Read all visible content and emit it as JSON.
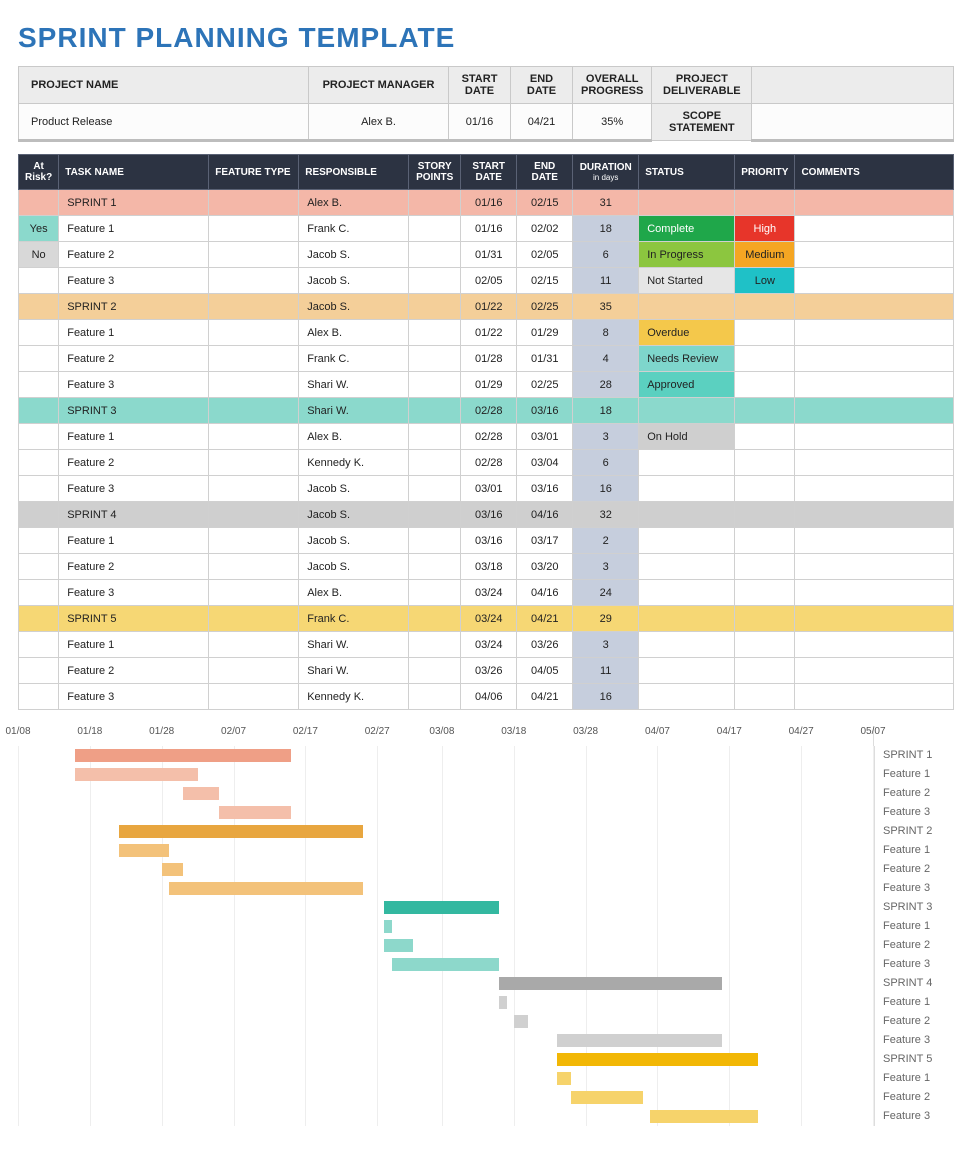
{
  "title": "SPRINT PLANNING TEMPLATE",
  "project_header": {
    "labels": {
      "project_name": "PROJECT NAME",
      "project_manager": "PROJECT MANAGER",
      "start_date": "START DATE",
      "end_date": "END DATE",
      "overall_progress": "OVERALL PROGRESS",
      "project_deliverable": "PROJECT DELIVERABLE",
      "scope_statement": "SCOPE STATEMENT"
    },
    "values": {
      "project_name": "Product Release",
      "project_manager": "Alex B.",
      "start_date": "01/16",
      "end_date": "04/21",
      "overall_progress": "35%",
      "project_deliverable": "",
      "scope_statement": ""
    }
  },
  "grid_headers": {
    "at_risk": "At Risk?",
    "task_name": "TASK NAME",
    "feature_type": "FEATURE TYPE",
    "responsible": "RESPONSIBLE",
    "story_points": "STORY POINTS",
    "start_date": "START DATE",
    "end_date": "END DATE",
    "duration": "DURATION",
    "duration_sub": "in days",
    "status": "STATUS",
    "priority": "PRIORITY",
    "comments": "COMMENTS"
  },
  "rows": [
    {
      "type": "sprint",
      "bg": "bg-sprint1",
      "task": "SPRINT 1",
      "responsible": "Alex B.",
      "start": "01/16",
      "end": "02/15",
      "dur": "31"
    },
    {
      "type": "task",
      "risk": "Yes",
      "task": "Feature 1",
      "responsible": "Frank C.",
      "start": "01/16",
      "end": "02/02",
      "dur": "18",
      "status": "Complete",
      "priority": "High"
    },
    {
      "type": "task",
      "risk": "No",
      "task": "Feature 2",
      "responsible": "Jacob S.",
      "start": "01/31",
      "end": "02/05",
      "dur": "6",
      "status": "In Progress",
      "priority": "Medium"
    },
    {
      "type": "task",
      "task": "Feature 3",
      "responsible": "Jacob S.",
      "start": "02/05",
      "end": "02/15",
      "dur": "11",
      "status": "Not Started",
      "priority": "Low"
    },
    {
      "type": "sprint",
      "bg": "bg-sprint2",
      "task": "SPRINT 2",
      "responsible": "Jacob S.",
      "start": "01/22",
      "end": "02/25",
      "dur": "35"
    },
    {
      "type": "task",
      "task": "Feature 1",
      "responsible": "Alex B.",
      "start": "01/22",
      "end": "01/29",
      "dur": "8",
      "status": "Overdue"
    },
    {
      "type": "task",
      "task": "Feature 2",
      "responsible": "Frank C.",
      "start": "01/28",
      "end": "01/31",
      "dur": "4",
      "status": "Needs Review"
    },
    {
      "type": "task",
      "task": "Feature 3",
      "responsible": "Shari W.",
      "start": "01/29",
      "end": "02/25",
      "dur": "28",
      "status": "Approved"
    },
    {
      "type": "sprint",
      "bg": "bg-sprint3",
      "task": "SPRINT 3",
      "responsible": "Shari W.",
      "start": "02/28",
      "end": "03/16",
      "dur": "18"
    },
    {
      "type": "task",
      "task": "Feature 1",
      "responsible": "Alex B.",
      "start": "02/28",
      "end": "03/01",
      "dur": "3",
      "status": "On Hold"
    },
    {
      "type": "task",
      "task": "Feature 2",
      "responsible": "Kennedy K.",
      "start": "02/28",
      "end": "03/04",
      "dur": "6"
    },
    {
      "type": "task",
      "task": "Feature 3",
      "responsible": "Jacob S.",
      "start": "03/01",
      "end": "03/16",
      "dur": "16"
    },
    {
      "type": "sprint",
      "bg": "bg-sprint4",
      "task": "SPRINT 4",
      "responsible": "Jacob S.",
      "start": "03/16",
      "end": "04/16",
      "dur": "32"
    },
    {
      "type": "task",
      "task": "Feature 1",
      "responsible": "Jacob S.",
      "start": "03/16",
      "end": "03/17",
      "dur": "2"
    },
    {
      "type": "task",
      "task": "Feature 2",
      "responsible": "Jacob S.",
      "start": "03/18",
      "end": "03/20",
      "dur": "3"
    },
    {
      "type": "task",
      "task": "Feature 3",
      "responsible": "Alex B.",
      "start": "03/24",
      "end": "04/16",
      "dur": "24"
    },
    {
      "type": "sprint",
      "bg": "bg-sprint5",
      "task": "SPRINT 5",
      "responsible": "Frank C.",
      "start": "03/24",
      "end": "04/21",
      "dur": "29"
    },
    {
      "type": "task",
      "task": "Feature 1",
      "responsible": "Shari W.",
      "start": "03/24",
      "end": "03/26",
      "dur": "3"
    },
    {
      "type": "task",
      "task": "Feature 2",
      "responsible": "Shari W.",
      "start": "03/26",
      "end": "04/05",
      "dur": "11"
    },
    {
      "type": "task",
      "task": "Feature 3",
      "responsible": "Kennedy K.",
      "start": "04/06",
      "end": "04/21",
      "dur": "16"
    }
  ],
  "chart_data": {
    "type": "bar",
    "title": "",
    "xlabel": "",
    "ylabel": "",
    "x_axis_ticks": [
      "01/08",
      "01/18",
      "01/28",
      "02/07",
      "02/17",
      "02/27",
      "03/08",
      "03/18",
      "03/28",
      "04/07",
      "04/17",
      "04/27",
      "05/07"
    ],
    "x_range_days": {
      "start_mmdd": "01/08",
      "end_mmdd": "05/07",
      "span_days": 119
    },
    "series": [
      {
        "name": "SPRINT 1",
        "label": "SPRINT 1",
        "start": "01/16",
        "end": "02/15",
        "color": "gc1a"
      },
      {
        "name": "Feature 1",
        "label": "Feature 1",
        "start": "01/16",
        "end": "02/02",
        "color": "gc1b"
      },
      {
        "name": "Feature 2",
        "label": "Feature 2",
        "start": "01/31",
        "end": "02/05",
        "color": "gc1b"
      },
      {
        "name": "Feature 3",
        "label": "Feature 3",
        "start": "02/05",
        "end": "02/15",
        "color": "gc1b"
      },
      {
        "name": "SPRINT 2",
        "label": "SPRINT 2",
        "start": "01/22",
        "end": "02/25",
        "color": "gc2a"
      },
      {
        "name": "Feature 1",
        "label": "Feature 1",
        "start": "01/22",
        "end": "01/29",
        "color": "gc2b"
      },
      {
        "name": "Feature 2",
        "label": "Feature 2",
        "start": "01/28",
        "end": "01/31",
        "color": "gc2b"
      },
      {
        "name": "Feature 3",
        "label": "Feature 3",
        "start": "01/29",
        "end": "02/25",
        "color": "gc2b"
      },
      {
        "name": "SPRINT 3",
        "label": "SPRINT 3",
        "start": "02/28",
        "end": "03/16",
        "color": "gc3a"
      },
      {
        "name": "Feature 1",
        "label": "Feature 1",
        "start": "02/28",
        "end": "03/01",
        "color": "gc3b"
      },
      {
        "name": "Feature 2",
        "label": "Feature 2",
        "start": "02/28",
        "end": "03/04",
        "color": "gc3b"
      },
      {
        "name": "Feature 3",
        "label": "Feature 3",
        "start": "03/01",
        "end": "03/16",
        "color": "gc3b"
      },
      {
        "name": "SPRINT 4",
        "label": "SPRINT 4",
        "start": "03/16",
        "end": "04/16",
        "color": "gc4a"
      },
      {
        "name": "Feature 1",
        "label": "Feature 1",
        "start": "03/16",
        "end": "03/17",
        "color": "gc4b"
      },
      {
        "name": "Feature 2",
        "label": "Feature 2",
        "start": "03/18",
        "end": "03/20",
        "color": "gc4b"
      },
      {
        "name": "Feature 3",
        "label": "Feature 3",
        "start": "03/24",
        "end": "04/16",
        "color": "gc4b"
      },
      {
        "name": "SPRINT 5",
        "label": "SPRINT 5",
        "start": "03/24",
        "end": "04/21",
        "color": "gc5a"
      },
      {
        "name": "Feature 1",
        "label": "Feature 1",
        "start": "03/24",
        "end": "03/26",
        "color": "gc5b"
      },
      {
        "name": "Feature 2",
        "label": "Feature 2",
        "start": "03/26",
        "end": "04/05",
        "color": "gc5b"
      },
      {
        "name": "Feature 3",
        "label": "Feature 3",
        "start": "04/06",
        "end": "04/21",
        "color": "gc5b"
      }
    ]
  }
}
